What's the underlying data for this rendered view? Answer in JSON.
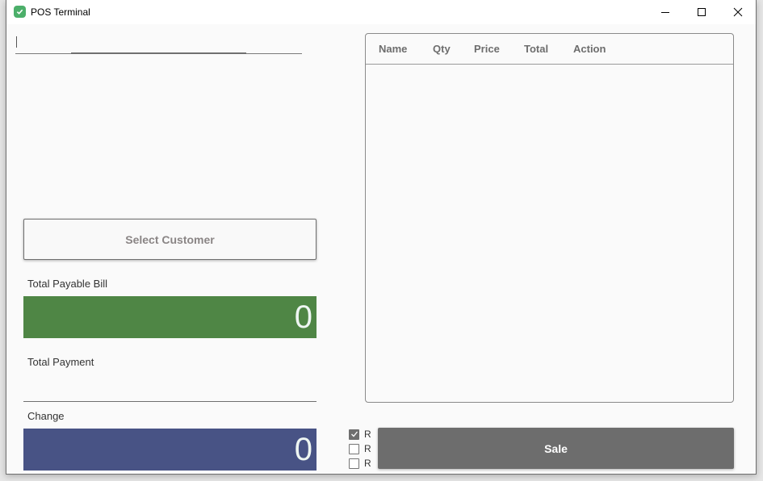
{
  "window": {
    "title": "POS Terminal",
    "icon": "check-circle-icon",
    "controls": [
      "minimize-icon",
      "maximize-icon",
      "close-icon"
    ]
  },
  "search": {
    "value": "",
    "placeholder": ""
  },
  "customer": {
    "select_label": "Select Customer"
  },
  "totals": {
    "payable_label": "Total Payable Bill",
    "payable_value": "0",
    "payment_label": "Total Payment",
    "payment_value": "",
    "change_label": "Change",
    "change_value": "0"
  },
  "cart": {
    "columns": [
      "Name",
      "Qty",
      "Price",
      "Total",
      "Action"
    ],
    "rows": []
  },
  "options": [
    {
      "label": "R",
      "checked": true
    },
    {
      "label": "R",
      "checked": false
    },
    {
      "label": "R",
      "checked": false
    }
  ],
  "actions": {
    "sale_label": "Sale"
  },
  "colors": {
    "payable_bg": "#4f8645",
    "change_bg": "#485385",
    "sale_bg": "#6d6d6d",
    "app_icon": "#4caf6a"
  }
}
